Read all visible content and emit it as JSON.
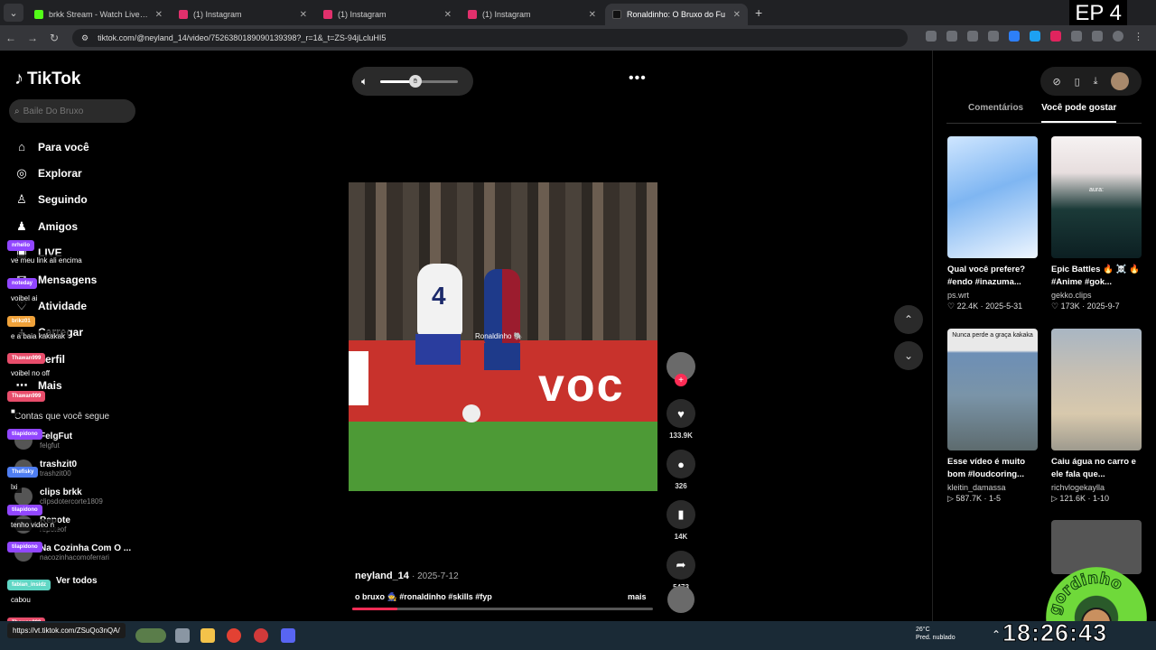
{
  "browser": {
    "tabs": [
      {
        "title": "brkk Stream - Watch Live on Ki",
        "color": "#53fc18",
        "active": false
      },
      {
        "title": "(1) Instagram",
        "color": "#e1306c",
        "active": false
      },
      {
        "title": "(1) Instagram",
        "color": "#e1306c",
        "active": false
      },
      {
        "title": "(1) Instagram",
        "color": "#e1306c",
        "active": false
      },
      {
        "title": "Ronaldinho: O Bruxo do Fu",
        "color": "#111111",
        "active": true
      }
    ],
    "new_tab": "+",
    "url": "tiktok.com/@neyland_14/video/7526380189090139398?_r=1&_t=ZS-94jLcluHI5",
    "episode_badge": "EP 4"
  },
  "tiktok": {
    "logo": "TikTok",
    "search_placeholder": "Baile Do Bruxo",
    "nav": [
      {
        "icon": "home-icon",
        "glyph": "⌂",
        "label": "Para você"
      },
      {
        "icon": "compass-icon",
        "glyph": "◎",
        "label": "Explorar"
      },
      {
        "icon": "following-icon",
        "glyph": "♙",
        "label": "Seguindo"
      },
      {
        "icon": "friends-icon",
        "glyph": "♟",
        "label": "Amigos"
      },
      {
        "icon": "live-icon",
        "glyph": "▣",
        "label": "LIVE"
      },
      {
        "icon": "messages-icon",
        "glyph": "✉",
        "label": "Mensagens"
      },
      {
        "icon": "activity-icon",
        "glyph": "♡",
        "label": "Atividade"
      },
      {
        "icon": "upload-icon",
        "glyph": "+",
        "label": "Carregar"
      },
      {
        "icon": "profile-icon",
        "glyph": "○",
        "label": "Perfil"
      },
      {
        "icon": "more-icon",
        "glyph": "⋯",
        "label": "Mais"
      }
    ],
    "following_title": "Contas que você segue",
    "following": [
      {
        "name": "FelgFut",
        "handle": "felgfut"
      },
      {
        "name": "trashzit0",
        "handle": "trashzit00"
      },
      {
        "name": "clips brkk",
        "handle": "clipsdotercorte1809"
      },
      {
        "name": "Repote",
        "handle": "repoteof"
      },
      {
        "name": "Na Cozinha Com O ...",
        "handle": "nacozinhacomoferrari"
      }
    ],
    "see_all": "Ver todos",
    "video": {
      "overlay_tag": "Ronaldinho 🐘",
      "banner_word": "voc",
      "jersey_number": "4",
      "author": "neyland_14",
      "date": "· 2025-7-12",
      "caption": "o bruxo 🧙 #ronaldinho #skills #fyp",
      "more": "mais",
      "progress": 0.15,
      "volume": 0.45
    },
    "actions": [
      {
        "icon": "heart-icon",
        "glyph": "♥",
        "count": "133.9K"
      },
      {
        "icon": "comment-icon",
        "glyph": "●",
        "count": "326"
      },
      {
        "icon": "bookmark-icon",
        "glyph": "▮",
        "count": "14K"
      },
      {
        "icon": "share-icon",
        "glyph": "➦",
        "count": "5473"
      }
    ],
    "right_tabs": [
      "Comentários",
      "Você pode gostar"
    ],
    "recommended": [
      {
        "title": "Qual você prefere? #endo #inazuma...",
        "author": "ps.wrt",
        "stats": "♡ 22.4K · 2025-5-31",
        "thumb": "linear-gradient(160deg,#cfe6ff 0%,#7fb6f2 45%,#eef6ff 100%)",
        "overlay": ""
      },
      {
        "title": "Epic Battles 🔥 ☠️ 🔥 #Anime #gok...",
        "author": "gekko.clips",
        "stats": "♡ 173K · 2025-9-7",
        "thumb": "linear-gradient(180deg,#f6f2f2 0%,#e7dede 30%,#1b3a38 60%,#0c1f22 100%)",
        "overlay": "aura:"
      },
      {
        "title": "Esse vídeo é muito bom #loudcoring...",
        "author": "kleitin_damassa",
        "stats": "▷ 587.7K · 1-5",
        "thumb": "linear-gradient(180deg,#e9e9e9 0%,#e9e9e9 18%,#6d8fb6 20%,#7a94a8 55%,#5d6b6e 100%)",
        "overlay": "Nunca perde a graça kakaka"
      },
      {
        "title": "Caiu água no carro e ele fala que...",
        "author": "richvlogekaylla",
        "stats": "▷ 121.6K · 1-10",
        "thumb": "linear-gradient(180deg,#a9b6c3 0%,#c8c0b2 40%,#d8c9ad 70%,#9e9a8e 100%)",
        "overlay": ""
      }
    ],
    "chat": [
      {
        "user": "nrhelio",
        "color": "#9146ff",
        "msg": "ve meu link ali encima"
      },
      {
        "user": "noteday",
        "color": "#9146ff",
        "msg": "voibel ai"
      },
      {
        "user": "brikz01",
        "color": "#f0a23a",
        "msg": "e a baia kakakak"
      },
      {
        "user": "Thawan999",
        "color": "#e84d6b",
        "msg": "voibel no off"
      },
      {
        "user": "Thawan999",
        "color": "#e84d6b",
        "msg": "■"
      },
      {
        "user": "tilapidono",
        "color": "#9146ff",
        "msg": ""
      },
      {
        "user": "Thefisky",
        "color": "#4f7ef2",
        "msg": "lxi"
      },
      {
        "user": "tilapidono",
        "color": "#9146ff",
        "msg": "tenho video n"
      },
      {
        "user": "tilapidono",
        "color": "#9146ff",
        "msg": ""
      },
      {
        "user": "fabian_insidz",
        "color": "#5fd6c4",
        "msg": "cabou"
      },
      {
        "user": "Thawan999",
        "color": "#e84d6b",
        "msg": ""
      }
    ],
    "link_bubble": "https://vt.tiktok.com/ZSuQo3nQA/"
  },
  "taskbar": {
    "weather_temp": "26°C",
    "weather_desc": "Pred. nublado",
    "clock": "18:26:43"
  },
  "streamer_logo_text": "gordinho"
}
